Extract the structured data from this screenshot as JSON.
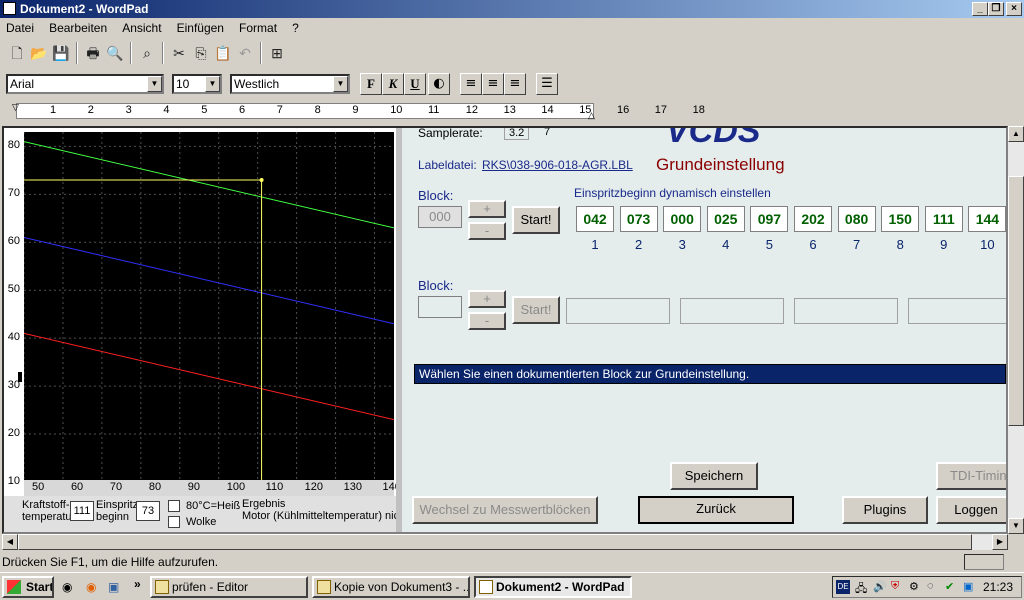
{
  "window": {
    "title": "Dokument2 - WordPad"
  },
  "menu": [
    "Datei",
    "Bearbeiten",
    "Ansicht",
    "Einfügen",
    "Format",
    "?"
  ],
  "format": {
    "font": "Arial",
    "size": "10",
    "script": "Westlich",
    "bold": "F",
    "italic": "K",
    "underline": "U"
  },
  "ruler": {
    "numbers": [
      "1",
      "2",
      "3",
      "4",
      "5",
      "6",
      "7",
      "8",
      "9",
      "10",
      "11",
      "12",
      "13",
      "14",
      "15",
      "16",
      "17",
      "18"
    ]
  },
  "chart_data": {
    "type": "line",
    "xlim": [
      50,
      145
    ],
    "ylim": [
      10,
      83
    ],
    "xticks": [
      "50",
      "60",
      "70",
      "80",
      "90",
      "100",
      "110",
      "120",
      "130",
      "140"
    ],
    "yticks": [
      "10",
      "20",
      "30",
      "40",
      "50",
      "60",
      "70",
      "80"
    ],
    "series": [
      {
        "color": "#40ff40",
        "x": [
          50,
          145
        ],
        "y": [
          81,
          63
        ]
      },
      {
        "color": "#3030ff",
        "x": [
          50,
          145
        ],
        "y": [
          61,
          43
        ]
      },
      {
        "color": "#ff2020",
        "x": [
          50,
          145
        ],
        "y": [
          41,
          23
        ]
      }
    ],
    "marker": {
      "color": "#ffff60",
      "x": 111,
      "y": 73
    }
  },
  "controls": {
    "kraftstoff_label_1": "Kraftstoff-",
    "kraftstoff_label_2": "temperatur",
    "kraftstoff_value": "111",
    "einspritz_label_1": "Einspritz-",
    "einspritz_label_2": "beginn",
    "einspritz_value": "73",
    "check1": "80°C=Heiß",
    "check2": "Wolke",
    "ergebnis_1": "Ergebnis",
    "ergebnis_2": "Motor (Kühlmitteltemperatur) nic"
  },
  "vcds": {
    "samplerate_label": "Samplerate:",
    "samplerate_value": "3.2",
    "samplerate_extra": "7",
    "logo": "VCDS",
    "labeldatei_label": "Labeldatei:",
    "labeldatei_link": "RKS\\038-906-018-AGR.LBL",
    "mode_title": "Grundeinstellung",
    "block1": {
      "label": "Block:",
      "value": "000",
      "plus": "+",
      "minus": "-",
      "start": "Start!",
      "group_title": "Einspritzbeginn dynamisch einstellen",
      "values": [
        "042",
        "073",
        "000",
        "025",
        "097",
        "202",
        "080",
        "150",
        "111",
        "144"
      ],
      "indices": [
        "1",
        "2",
        "3",
        "4",
        "5",
        "6",
        "7",
        "8",
        "9",
        "10"
      ]
    },
    "block2": {
      "label": "Block:",
      "plus": "+",
      "minus": "-",
      "start": "Start!"
    },
    "message": "Wählen Sie einen dokumentierten Block zur Grundeinstellung.",
    "buttons": {
      "speichern": "Speichern",
      "tdi": "TDI-Timing",
      "wechsel": "Wechsel zu Messwertblöcken",
      "zurueck": "Zurück",
      "plugins": "Plugins",
      "loggen": "Loggen"
    }
  },
  "status": "Drücken Sie F1, um die Hilfe aufzurufen.",
  "taskbar": {
    "start": "Start",
    "tasks": [
      "prüfen - Editor",
      "Kopie von Dokument3 - ...",
      "Dokument2 - WordPad"
    ],
    "tray_lang": "DE",
    "clock": "21:23"
  }
}
